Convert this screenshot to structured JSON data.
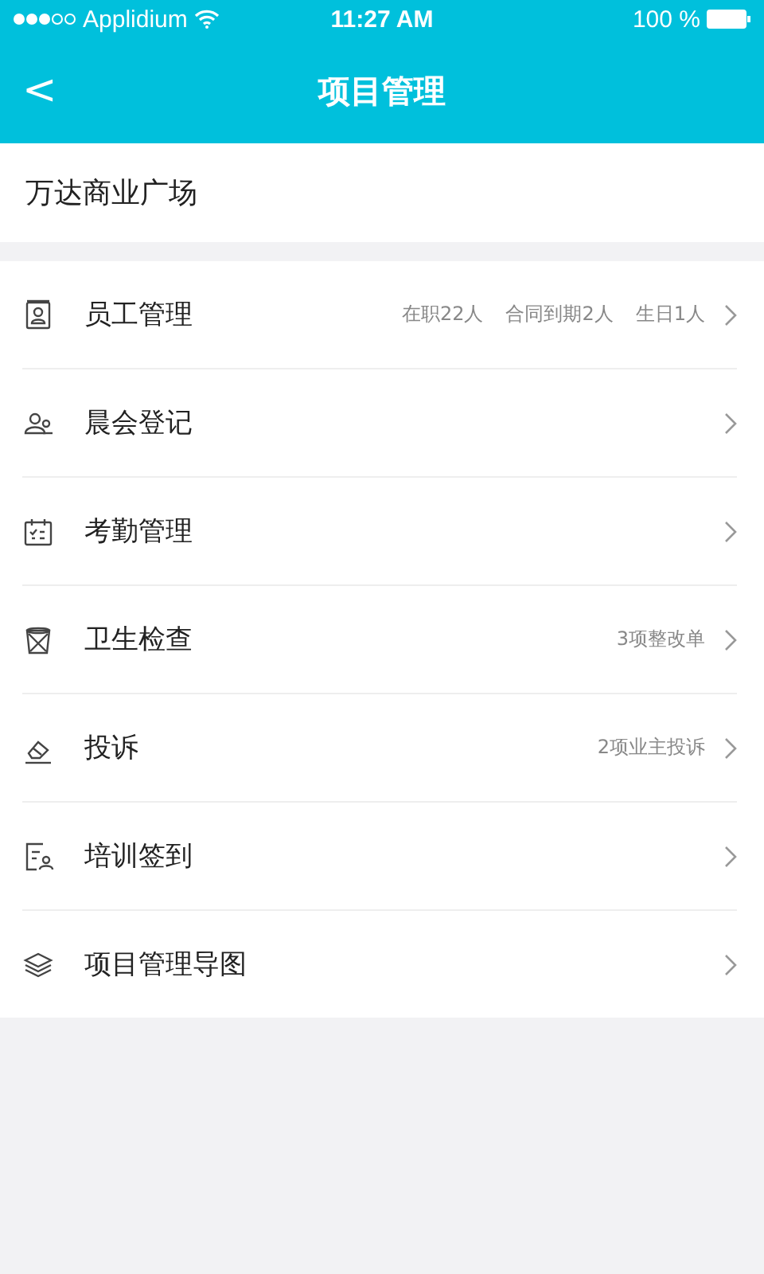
{
  "status_bar": {
    "carrier": "Applidium",
    "time": "11:27 AM",
    "battery": "100 %"
  },
  "nav_bar": {
    "back": "<",
    "title": "项目管理"
  },
  "project": {
    "name": "万达商业广场"
  },
  "menu": [
    {
      "label": "员工管理",
      "details": [
        "在职22人",
        "合同到期2人",
        "生日1人"
      ]
    },
    {
      "label": "晨会登记"
    },
    {
      "label": "考勤管理"
    },
    {
      "label": "卫生检查",
      "details": [
        "3项整改单"
      ]
    },
    {
      "label": "投诉",
      "details": [
        "2项业主投诉"
      ]
    },
    {
      "label": "培训签到"
    },
    {
      "label": "项目管理导图"
    }
  ]
}
